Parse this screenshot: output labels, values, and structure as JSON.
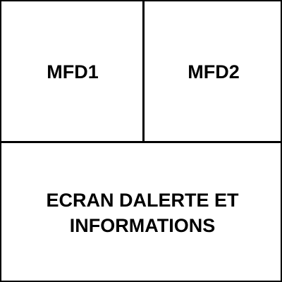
{
  "panels": {
    "mfd1": {
      "label": "MFD1"
    },
    "mfd2": {
      "label": "MFD2"
    },
    "alert": {
      "label": "ECRAN DALERTE ET\nINFORMATIONS"
    }
  },
  "colors": {
    "background": "#ffffff",
    "border": "#000000",
    "text": "#000000"
  }
}
